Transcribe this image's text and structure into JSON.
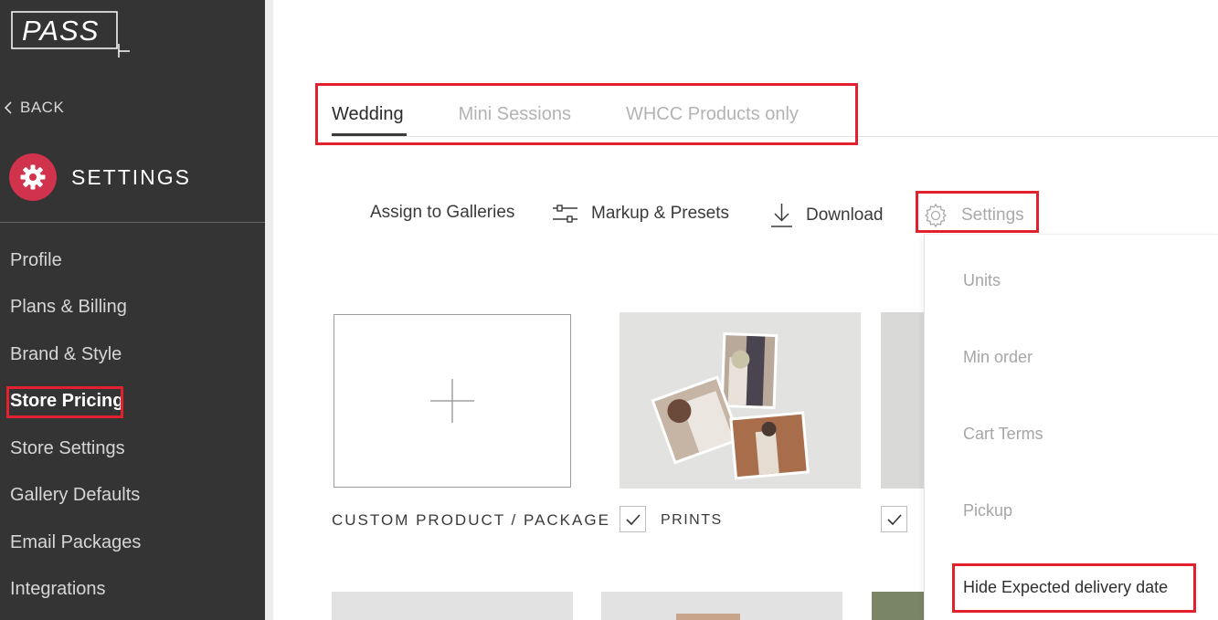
{
  "brand": {
    "logo_text": "PASS"
  },
  "sidebar": {
    "back_label": "BACK",
    "section_title": "SETTINGS",
    "items": [
      {
        "label": "Profile"
      },
      {
        "label": "Plans & Billing"
      },
      {
        "label": "Brand & Style"
      },
      {
        "label": "Store Pricing",
        "active": true
      },
      {
        "label": "Store Settings"
      },
      {
        "label": "Gallery Defaults"
      },
      {
        "label": "Email Packages"
      },
      {
        "label": "Integrations"
      }
    ]
  },
  "tabs": [
    {
      "label": "Wedding",
      "active": true
    },
    {
      "label": "Mini Sessions"
    },
    {
      "label": "WHCC Products only"
    }
  ],
  "toolbar": {
    "assign_label": "Assign to Galleries",
    "markup_label": "Markup & Presets",
    "download_label": "Download",
    "settings_label": "Settings"
  },
  "products": {
    "custom_label": "CUSTOM PRODUCT / PACKAGE",
    "prints_label": "PRINTS",
    "prints_checked": true,
    "third_checked": true
  },
  "settings_menu": {
    "items": [
      {
        "label": "Units"
      },
      {
        "label": "Min order"
      },
      {
        "label": "Cart Terms"
      },
      {
        "label": "Pickup"
      },
      {
        "label": "Hide Expected delivery date"
      }
    ]
  },
  "colors": {
    "sidebar_bg": "#343434",
    "accent": "#d1324c",
    "highlight": "#e2202e"
  }
}
